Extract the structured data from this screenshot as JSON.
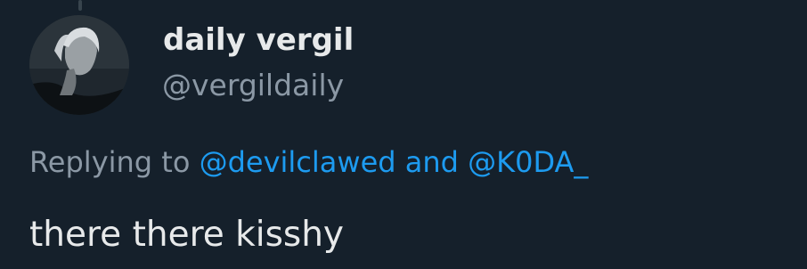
{
  "tweet": {
    "author": {
      "display_name": "daily vergil",
      "handle": "@vergildaily",
      "avatar_icon": "profile-avatar-silver-haired-man"
    },
    "reply": {
      "prefix": "Replying to",
      "mention_1": "@devilclawed",
      "conjunction": "and",
      "mention_2": "@K0DA_"
    },
    "text": "there there kisshy"
  },
  "colors": {
    "background": "#15202b",
    "primary_text": "#e7e9ea",
    "secondary_text": "#8b98a5",
    "link": "#1d9bf0"
  }
}
